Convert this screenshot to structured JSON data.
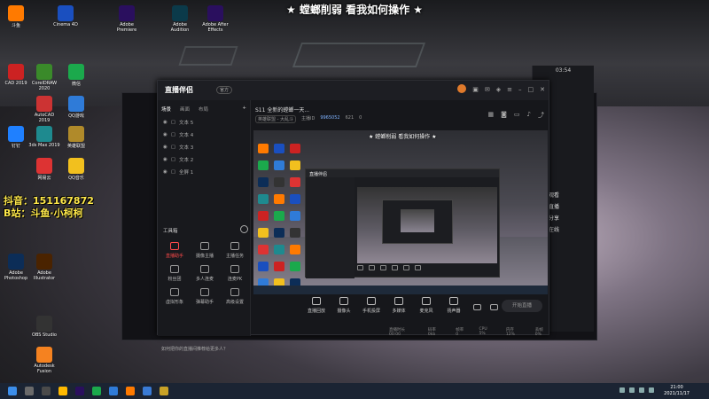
{
  "banner": "★ 螳螂削弱 看我如何操作 ★",
  "desktop_icons": [
    {
      "label": "斗鱼",
      "color": "#ff7a00"
    },
    {
      "label": "Cinema 4D",
      "color": "#1a4fbf"
    },
    {
      "label": "Adobe Premiere",
      "color": "#2a0f5e"
    },
    {
      "label": "Adobe Audition",
      "color": "#0b3a4a"
    },
    {
      "label": "Adobe After Effects",
      "color": "#2a0f5e"
    },
    {
      "label": "CAD 2019",
      "color": "#c22"
    },
    {
      "label": "CorelDRAW 2020",
      "color": "#3a8a2a"
    },
    {
      "label": "微信",
      "color": "#1ba94c"
    },
    {
      "label": "AutoCAD 2019",
      "color": "#c33"
    },
    {
      "label": "QQ游戏",
      "color": "#2f7bd8"
    },
    {
      "label": "钉钉",
      "color": "#1f80ff"
    },
    {
      "label": "3ds Max 2019",
      "color": "#1e8a8f"
    },
    {
      "label": "英雄联盟",
      "color": "#b08a2a"
    },
    {
      "label": "网易云",
      "color": "#d33"
    },
    {
      "label": "QQ音乐",
      "color": "#f2c01e"
    },
    {
      "label": "Adobe Photoshop",
      "color": "#0c2d57"
    },
    {
      "label": "Adobe Illustrator",
      "color": "#4a2300"
    },
    {
      "label": "OBS Studio",
      "color": "#333"
    },
    {
      "label": "Autodesk Fusion",
      "color": "#f58220"
    }
  ],
  "streamer": {
    "line1": "抖音：151167872",
    "line2": "B站：斗鱼·小柯柯"
  },
  "app": {
    "name": "直播伴侣",
    "version": "官方",
    "tabs": [
      "场景",
      "画面",
      "布局"
    ],
    "active_tab": "场景",
    "scenes": [
      "文本 5",
      "文本 4",
      "文本 3",
      "文本 2",
      "全屏 1"
    ],
    "tools_header": "工具箱",
    "tools": [
      {
        "label": "直播助手",
        "red": true
      },
      {
        "label": "摄像主播",
        "red": false
      },
      {
        "label": "主播任务",
        "red": false
      },
      {
        "label": "粉丝团",
        "red": false
      },
      {
        "label": "多人连麦",
        "red": false
      },
      {
        "label": "连麦PK",
        "red": false
      },
      {
        "label": "虚拟形象",
        "red": false
      },
      {
        "label": "弹幕助手",
        "red": false
      },
      {
        "label": "高级设置",
        "red": false
      }
    ],
    "notice": "如何把你的直播间推荐给更多人？",
    "room_title": "S11 全新的螳螂一天...",
    "meta": {
      "category": "英雄联盟 - 大乱斗",
      "id_label": "主播ID",
      "id": "9965052",
      "stat1": "621",
      "stat2": "0"
    },
    "subtitle": "★ 螳螂削弱 看我如何操作 ★",
    "controls": [
      "直播回放",
      "摄像头",
      "手机投屏",
      "多媒体",
      "麦克风",
      "扬声器"
    ],
    "go_live": "开始直播",
    "status": [
      "直播时长 00:00",
      "码率 0kb",
      "帧率 0",
      "CPU 5%",
      "内存 12%",
      "丢帧 0%"
    ]
  },
  "right_panel": {
    "time": "03:54",
    "items": [
      "观看",
      "直播",
      "分享",
      "在线"
    ]
  },
  "taskbar": {
    "time": "21:00",
    "date": "2021/11/17"
  }
}
